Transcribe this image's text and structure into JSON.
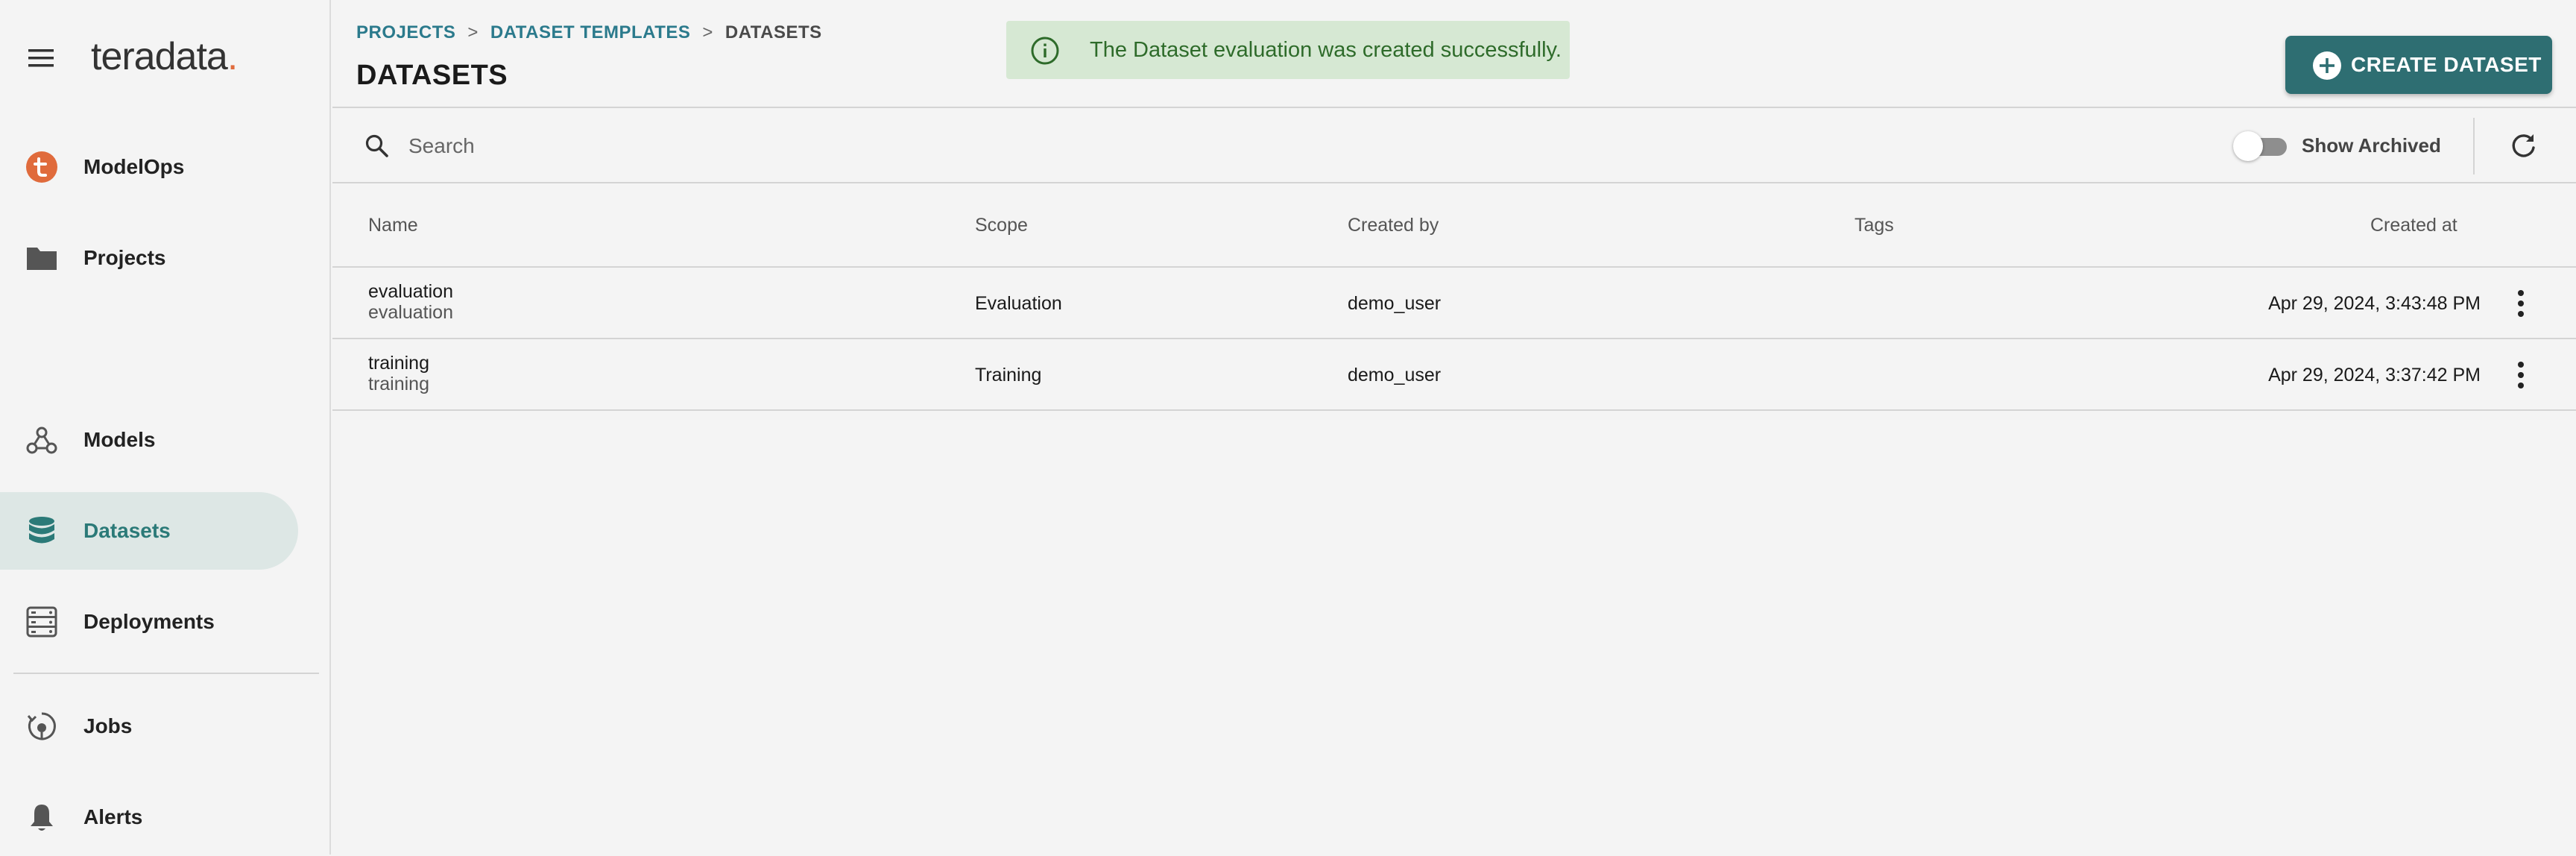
{
  "app": {
    "logo_text": "teradata",
    "logo_dot": "."
  },
  "sidebar": {
    "items": [
      {
        "label": "ModelOps",
        "icon": "teradata-t-icon"
      },
      {
        "label": "Projects",
        "icon": "folder-icon"
      },
      {
        "label": "Models",
        "icon": "models-webhook-icon"
      },
      {
        "label": "Datasets",
        "icon": "database-icon",
        "active": true
      },
      {
        "label": "Deployments",
        "icon": "deployments-icon"
      },
      {
        "label": "Jobs",
        "icon": "jobs-icon"
      },
      {
        "label": "Alerts",
        "icon": "bell-icon"
      }
    ]
  },
  "breadcrumb": {
    "items": [
      "PROJECTS",
      "DATASET TEMPLATES",
      "DATASETS"
    ],
    "separator": ">"
  },
  "page": {
    "title": "DATASETS"
  },
  "toast": {
    "message": "The Dataset evaluation was created successfully."
  },
  "actions": {
    "create_label": "CREATE DATASET"
  },
  "toolbar": {
    "search_placeholder": "Search",
    "search_value": "",
    "show_archived_label": "Show Archived",
    "show_archived": false
  },
  "table": {
    "columns": [
      "Name",
      "Scope",
      "Created by",
      "Tags",
      "Created at"
    ],
    "rows": [
      {
        "name": "evaluation",
        "subname": "evaluation",
        "scope": "Evaluation",
        "created_by": "demo_user",
        "tags": "",
        "created_at": "Apr 29, 2024, 3:43:48 PM"
      },
      {
        "name": "training",
        "subname": "training",
        "scope": "Training",
        "created_by": "demo_user",
        "tags": "",
        "created_at": "Apr 29, 2024, 3:37:42 PM"
      }
    ]
  },
  "colors": {
    "accent": "#2b7a78",
    "primary_button": "#2e6e72",
    "toast_bg": "#d6e8d3",
    "toast_text": "#2e6b2a",
    "logo_accent": "#e06b3c",
    "active_nav_bg": "#dde7e5"
  }
}
